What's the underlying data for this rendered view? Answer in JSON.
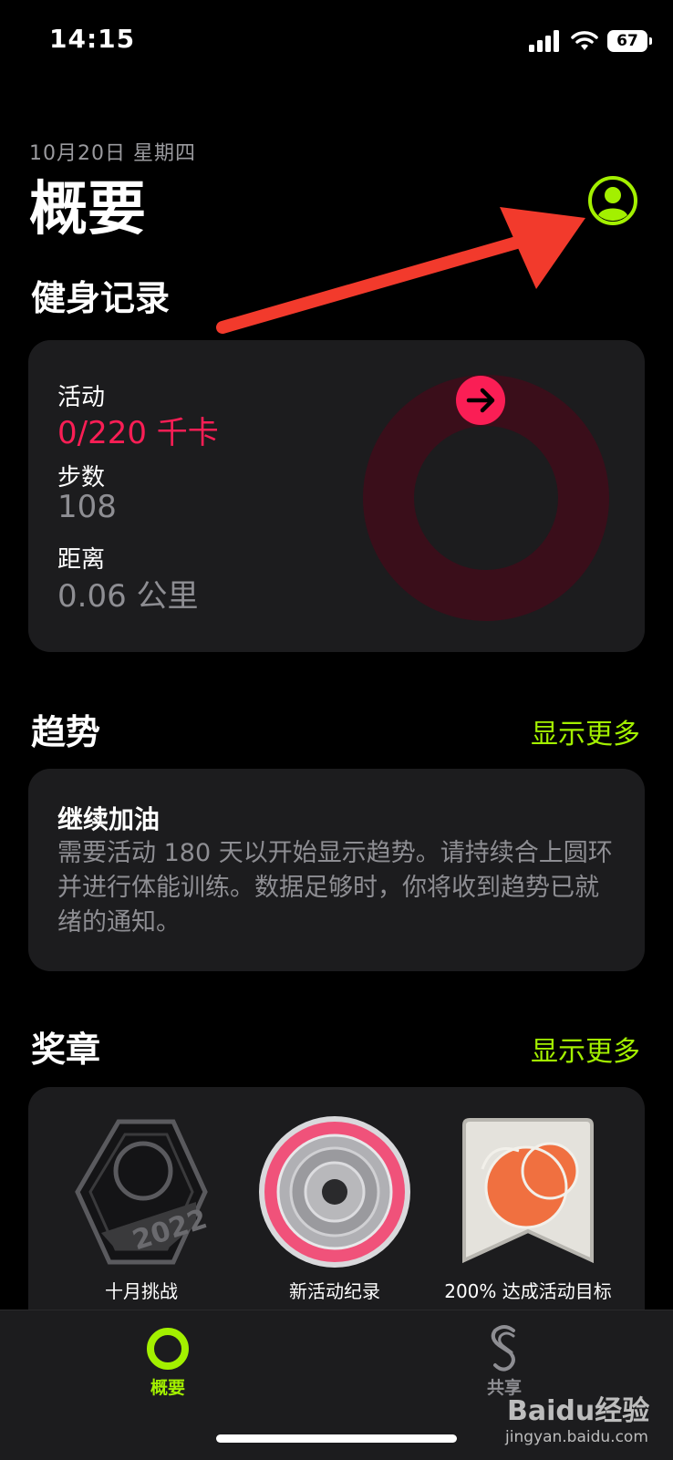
{
  "status_bar": {
    "time": "14:15",
    "battery": "67"
  },
  "header": {
    "date": "10月20日 星期四",
    "title": "概要"
  },
  "fitness": {
    "section_title": "健身记录",
    "activity_label": "活动",
    "activity_value": "0/220 千卡",
    "steps_label": "步数",
    "steps_value": "108",
    "distance_label": "距离",
    "distance_value": "0.06 公里",
    "move_ring_progress": 0
  },
  "trends": {
    "section_title": "趋势",
    "show_more": "显示更多",
    "card_title": "继续加油",
    "card_text": "需要活动 180 天以开始显示趋势。请持续合上圆环并进行体能训练。数据足够时，你将收到趋势已就绪的通知。"
  },
  "awards": {
    "section_title": "奖章",
    "show_more": "显示更多",
    "items": [
      {
        "label": "十月挑战"
      },
      {
        "label": "新活动纪录"
      },
      {
        "label": "200% 达成活动目标"
      }
    ]
  },
  "tabbar": {
    "tabs": [
      {
        "label": "概要",
        "active": true
      },
      {
        "label": "共享",
        "active": false
      }
    ]
  },
  "watermark": {
    "brand": "Baidu经验",
    "url": "jingyan.baidu.com"
  },
  "colors": {
    "accent": "#a3f000",
    "move": "#fa1e55",
    "card": "#1c1c1e"
  }
}
